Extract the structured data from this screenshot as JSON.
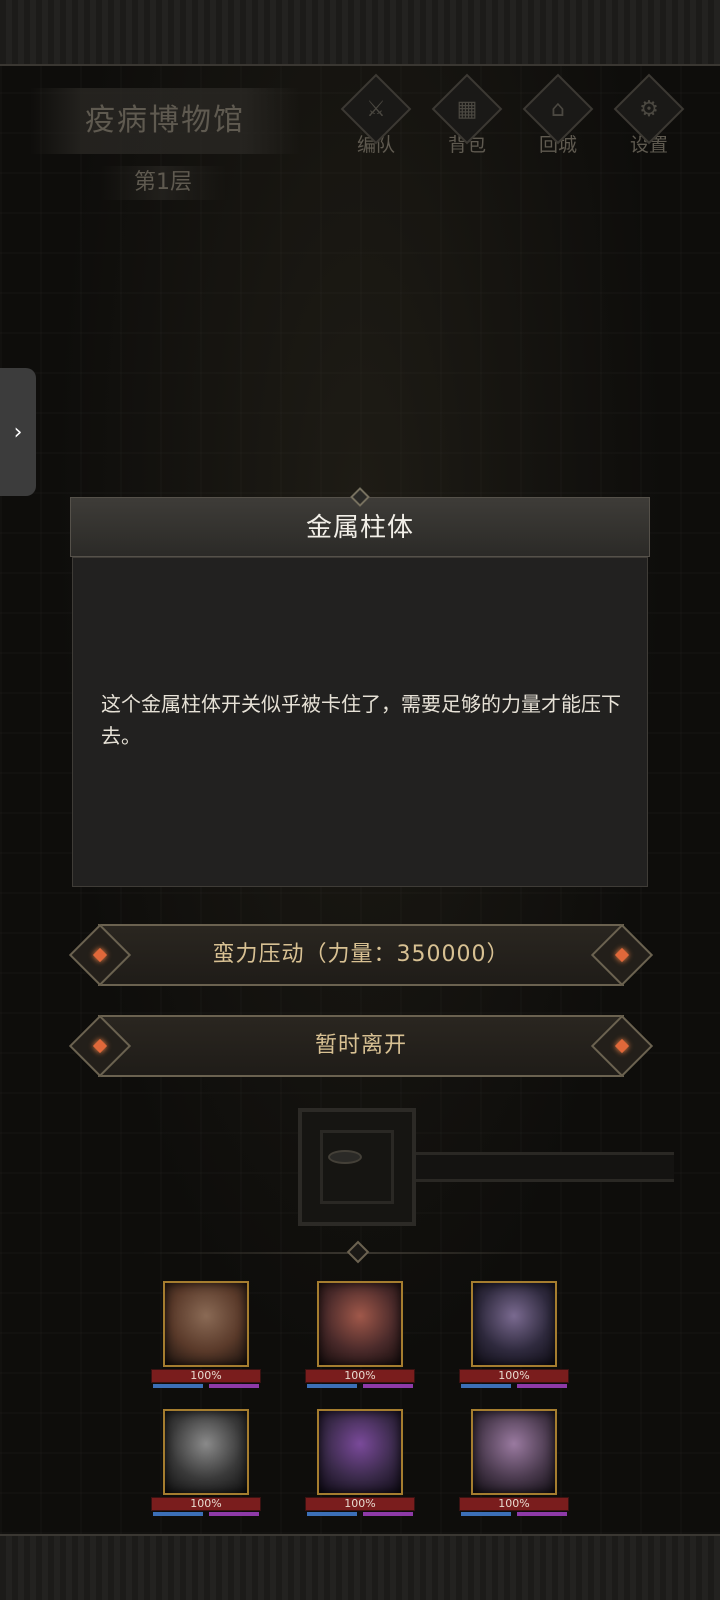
{
  "location": {
    "name": "疫病博物馆",
    "floor": "第1层"
  },
  "top_menu": [
    {
      "label": "编队",
      "icon": "helmet-icon",
      "glyph": "⚔"
    },
    {
      "label": "背包",
      "icon": "backpack-icon",
      "glyph": "▦"
    },
    {
      "label": "回城",
      "icon": "door-icon",
      "glyph": "⌂"
    },
    {
      "label": "设置",
      "icon": "gear-icon",
      "glyph": "⚙"
    }
  ],
  "side_tab": {
    "glyph": "›"
  },
  "dialog": {
    "title": "金属柱体",
    "text": "这个金属柱体开关似乎被卡住了，需要足够的力量才能压下去。"
  },
  "actions": {
    "force_label": "蛮力压动（力量：350000）",
    "leave_label": "暂时离开"
  },
  "party": [
    {
      "hp": "100%",
      "color": "#5a3a2a"
    },
    {
      "hp": "100%",
      "color": "#4a2a2a"
    },
    {
      "hp": "100%",
      "color": "#2f2a3e"
    },
    {
      "hp": "100%",
      "color": "#3a3a3a"
    },
    {
      "hp": "100%",
      "color": "#3a2a4a"
    },
    {
      "hp": "100%",
      "color": "#4a3a4e"
    }
  ],
  "colors": {
    "accent_gold": "#a57d2f",
    "ember": "#e0683a",
    "hp_red": "#7a1d1d",
    "mp_blue": "#3c6fb7"
  }
}
